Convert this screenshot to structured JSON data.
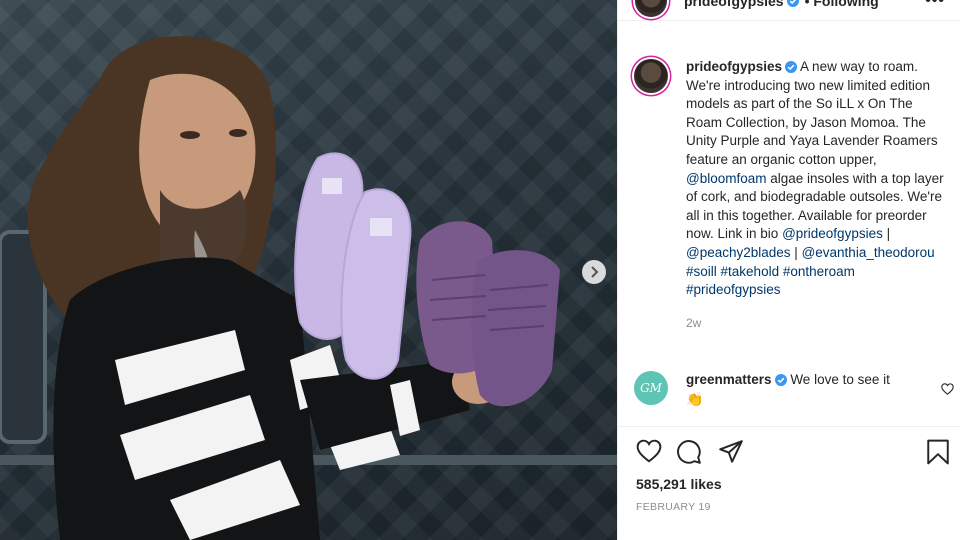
{
  "post": {
    "username": "prideofgypsies",
    "follow_status": "• Following",
    "more_label": "•••",
    "caption_intro": "A new way to roam. We're introducing two new limited edition models as part of the So iLL x On The Roam Collection, by Jason Momoa. The Unity Purple and Yaya Lavender Roamers feature an organic cotton upper,",
    "mention_bloomfoam": "@bloomfoam",
    "caption_mid": "algae insoles with a top layer of cork, and biodegradable outsoles. We're all in this together. Available for preorder now. Link in bio",
    "mention_prideofgypsies": "@prideofgypsies",
    "sep1": "|",
    "mention_peachy": "@peachy2blades",
    "sep2": "|",
    "mention_evanthia": "@evanthia_theodorou",
    "tag_soill": "#soill",
    "tag_takehold": "#takehold",
    "tag_ontheroam": "#ontheroam",
    "tag_prideofgypsies": "#prideofgypsies",
    "time_ago": "2w",
    "likes": "585,291 likes",
    "date": "FEBRUARY 19"
  },
  "comment": {
    "avatar_text": "GM",
    "username": "greenmatters",
    "text": "We love to see it",
    "emoji": "👏"
  },
  "icons": {
    "like": "heart-icon",
    "comment": "comment-icon",
    "share": "share-icon",
    "save": "bookmark-icon",
    "verified": "verified-badge-icon",
    "next": "chevron-right-icon"
  },
  "colors": {
    "link": "#00376b",
    "verified": "#3897f0",
    "story_ring": "#d6249f",
    "secondary_text": "#8e8e8e"
  }
}
